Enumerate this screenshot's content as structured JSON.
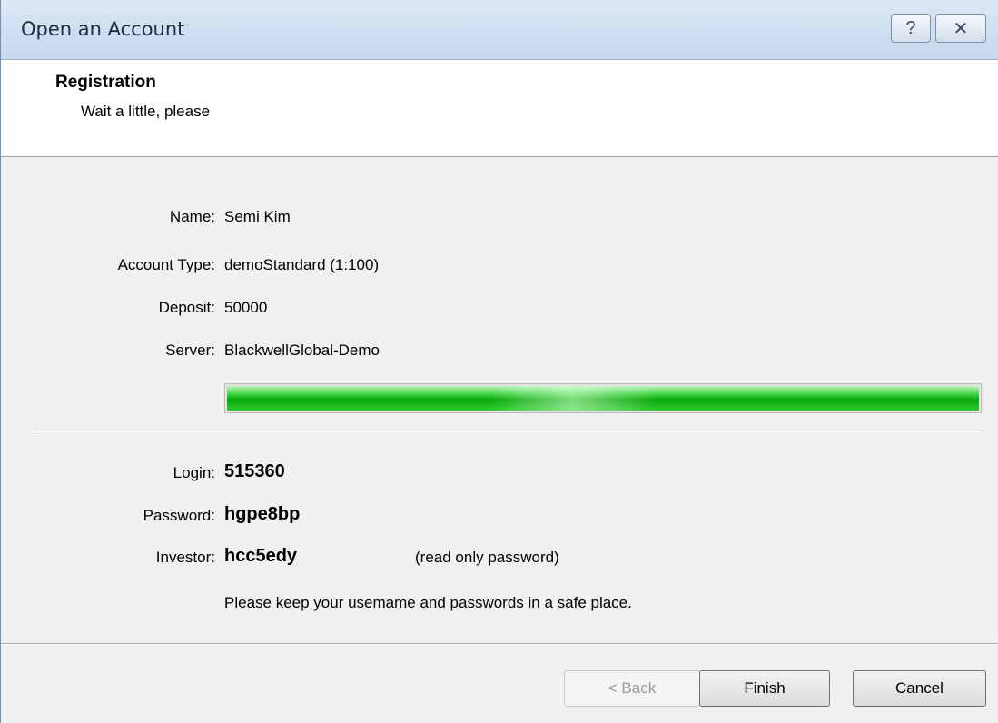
{
  "window": {
    "title": "Open an Account",
    "help_glyph": "?",
    "close_glyph": "✕"
  },
  "header": {
    "title": "Registration",
    "subtitle": "Wait a little, please"
  },
  "details": [
    {
      "label": "Name:",
      "value": "Semi Kim"
    },
    {
      "label": "Account Type:",
      "value": "demoStandard (1:100)"
    },
    {
      "label": "Deposit:",
      "value": "50000"
    },
    {
      "label": "Server:",
      "value": "BlackwellGlobal-Demo"
    }
  ],
  "progress": {
    "fraction": 1.0,
    "color": "#0aa80a"
  },
  "credentials": {
    "login_label": "Login:",
    "login_value": "515360",
    "password_label": "Password:",
    "password_value": "hgpe8bp",
    "investor_label": "Investor:",
    "investor_value": "hcc5edy",
    "investor_note": "(read only password)",
    "notice": "Please keep your usemame and passwords in a safe place."
  },
  "buttons": {
    "back": "< Back",
    "finish": "Finish",
    "cancel": "Cancel"
  }
}
